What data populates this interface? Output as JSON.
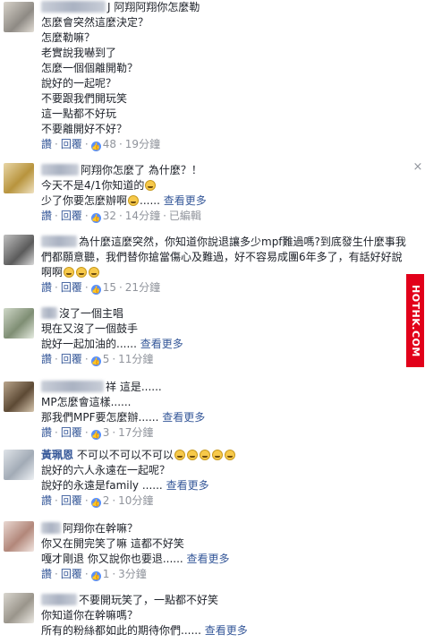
{
  "labels": {
    "like": "讚",
    "reply": "回覆",
    "see_more": "查看更多",
    "edited": "已編輯"
  },
  "comments": [
    {
      "author": "",
      "lines": [
        "J 阿翔阿翔你怎麼勒",
        "怎麼會突然這麼決定？",
        "怎麼勒嘛？",
        "老實說我嚇到了",
        "怎麼一個個離開勒？",
        "說好的一起呢？",
        "不要跟我們開玩笑",
        "這一點都不好玩",
        "不要離開好不好？"
      ],
      "likes": "48",
      "time": "19分鐘"
    },
    {
      "author": "",
      "lines": [
        "阿翔你怎麼了 為什麼？！",
        "今天不是4/1你知道的",
        "少了你要怎麼辦啊"
      ],
      "likes": "32",
      "time": "14分鐘"
    },
    {
      "author": "",
      "lines": [
        "為什麼這麼突然，你知道你說退讓多少mpf難過嗎?到底發生什麼事我們都願意聽，我們替你搶當傷心及難過，好不容易成團6年多了，有話好好說啊啊"
      ],
      "likes": "15",
      "time": "21分鐘"
    },
    {
      "author": "",
      "lines": [
        "沒了一個主唱",
        "現在又沒了一個鼓手",
        "說好一起加油的"
      ],
      "likes": "5",
      "time": "11分鐘"
    },
    {
      "author": "",
      "lines": [
        "祥 這是......",
        "MP怎麼會這樣......",
        "那我們MPF要怎麼辦"
      ],
      "likes": "3",
      "time": "17分鐘"
    },
    {
      "author": "黃珮恩",
      "lines": [
        "不可以不可以不可以",
        "說好的六人永遠在一起呢？",
        "說好的永遠是family"
      ],
      "likes": "2",
      "time": "10分鐘"
    },
    {
      "author": "",
      "lines": [
        "阿翔你在幹嘛？",
        "你又在開完笑了嘛 這都不好笑",
        "嘎才剛退 你又說你也要退"
      ],
      "likes": "1",
      "time": "3分鐘"
    },
    {
      "author": "",
      "lines": [
        "不要開玩笑了，一點都不好笑",
        "你知道你在幹嘛嗎？",
        "所有的粉絲都如此的期待你們"
      ],
      "likes": "",
      "time": ""
    }
  ],
  "close_icon": "×",
  "watermark": "HOTHK.COM"
}
